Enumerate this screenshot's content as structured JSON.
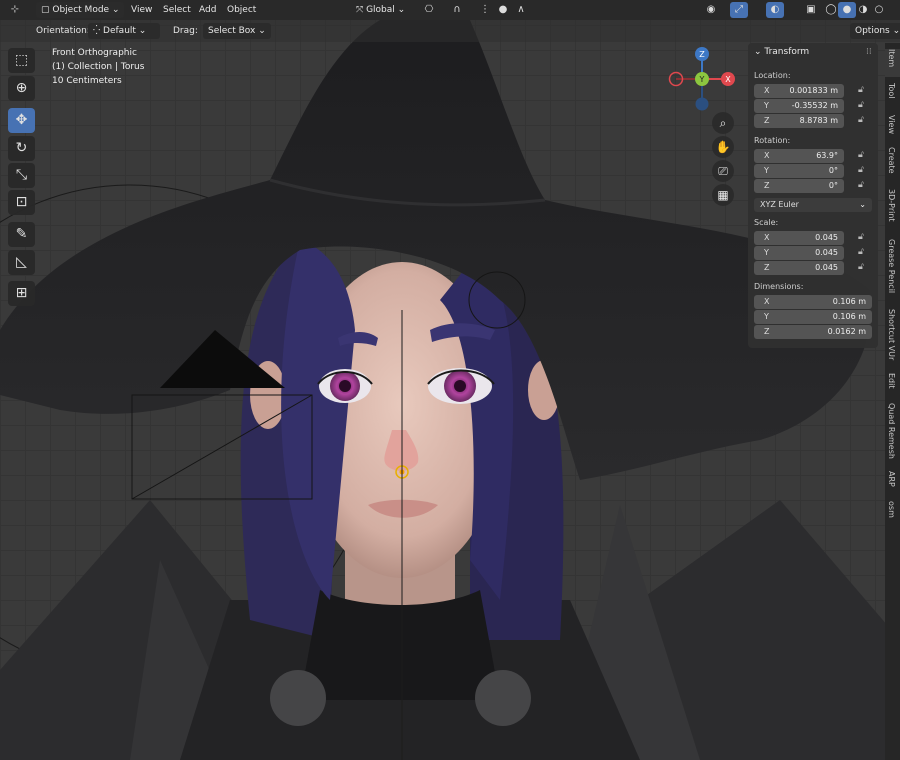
{
  "header": {
    "mode": "Object Mode",
    "menus": [
      "View",
      "Select",
      "Add",
      "Object"
    ],
    "transform_orientation": "Global"
  },
  "tool_header": {
    "orientation_label": "Orientation:",
    "orientation_value": "Default",
    "drag_label": "Drag:",
    "drag_value": "Select Box",
    "options": "Options"
  },
  "viewport_overlay": {
    "view_name": "Front Orthographic",
    "collection": "(1) Collection | Torus",
    "grid_scale": "10 Centimeters"
  },
  "gizmo": {
    "z": "Z",
    "y": "Y",
    "x": "X"
  },
  "tools": [
    "select-box",
    "cursor",
    "move",
    "rotate",
    "scale",
    "transform",
    "annotate",
    "measure",
    "add-cube"
  ],
  "transform_panel": {
    "title": "Transform",
    "location_label": "Location:",
    "location": [
      {
        "axis": "X",
        "value": "0.001833 m"
      },
      {
        "axis": "Y",
        "value": "-0.35532 m"
      },
      {
        "axis": "Z",
        "value": "8.8783 m"
      }
    ],
    "rotation_label": "Rotation:",
    "rotation": [
      {
        "axis": "X",
        "value": "63.9°"
      },
      {
        "axis": "Y",
        "value": "0°"
      },
      {
        "axis": "Z",
        "value": "0°"
      }
    ],
    "rotation_mode": "XYZ Euler",
    "scale_label": "Scale:",
    "scale": [
      {
        "axis": "X",
        "value": "0.045"
      },
      {
        "axis": "Y",
        "value": "0.045"
      },
      {
        "axis": "Z",
        "value": "0.045"
      }
    ],
    "dimensions_label": "Dimensions:",
    "dimensions": [
      {
        "axis": "X",
        "value": "0.106 m"
      },
      {
        "axis": "Y",
        "value": "0.106 m"
      },
      {
        "axis": "Z",
        "value": "0.0162 m"
      }
    ]
  },
  "sidebar_tabs": [
    "Item",
    "Tool",
    "View",
    "Create",
    "3D-Print",
    "Grease Pencil",
    "Shortcut VUr",
    "Edit",
    "Quad Remesh",
    "ARP",
    "osm"
  ],
  "colors": {
    "accent": "#4772b3",
    "gizmo_x": "#e0484e",
    "gizmo_y": "#8cc63f",
    "gizmo_z": "#3d78c6"
  }
}
